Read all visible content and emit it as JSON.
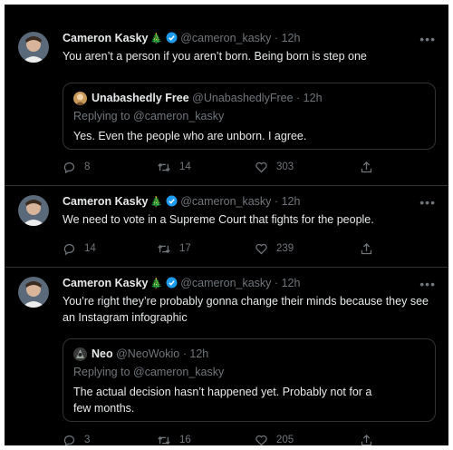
{
  "tweets": [
    {
      "display_name": "Cameron Kasky",
      "badge": "🎄",
      "handle": "@cameron_kasky",
      "separator": "·",
      "time": "12h",
      "more": "•••",
      "text": "You aren’t a person if you aren’t born. Being born is step one",
      "quote": {
        "display_name": "Unabashedly Free",
        "handle": "@UnabashedlyFree",
        "separator": "·",
        "time": "12h",
        "replying": "Replying to @cameron_kasky",
        "text": "Yes. Even the people who are unborn. I agree."
      },
      "replies": "8",
      "retweets": "14",
      "likes": "303"
    },
    {
      "display_name": "Cameron Kasky",
      "badge": "🎄",
      "handle": "@cameron_kasky",
      "separator": "·",
      "time": "12h",
      "more": "•••",
      "text": "We need to vote in a Supreme Court that fights for the people.",
      "replies": "14",
      "retweets": "17",
      "likes": "239"
    },
    {
      "display_name": "Cameron Kasky",
      "badge": "🎄",
      "handle": "@cameron_kasky",
      "separator": "·",
      "time": "12h",
      "more": "•••",
      "text": "You’re right they’re probably gonna change their minds because they see an Instagram infographic",
      "quote": {
        "display_name": "Neo",
        "handle": "@NeoWokio",
        "separator": "·",
        "time": "12h",
        "replying": "Replying to @cameron_kasky",
        "text": "The actual decision hasn’t happened yet. Probably not for a few months."
      },
      "replies": "3",
      "retweets": "16",
      "likes": "205"
    }
  ],
  "colors": {
    "background": "#000000",
    "text": "#e7e9ea",
    "muted": "#71767b",
    "border": "#2f3336",
    "verified": "#1d9bf0"
  }
}
